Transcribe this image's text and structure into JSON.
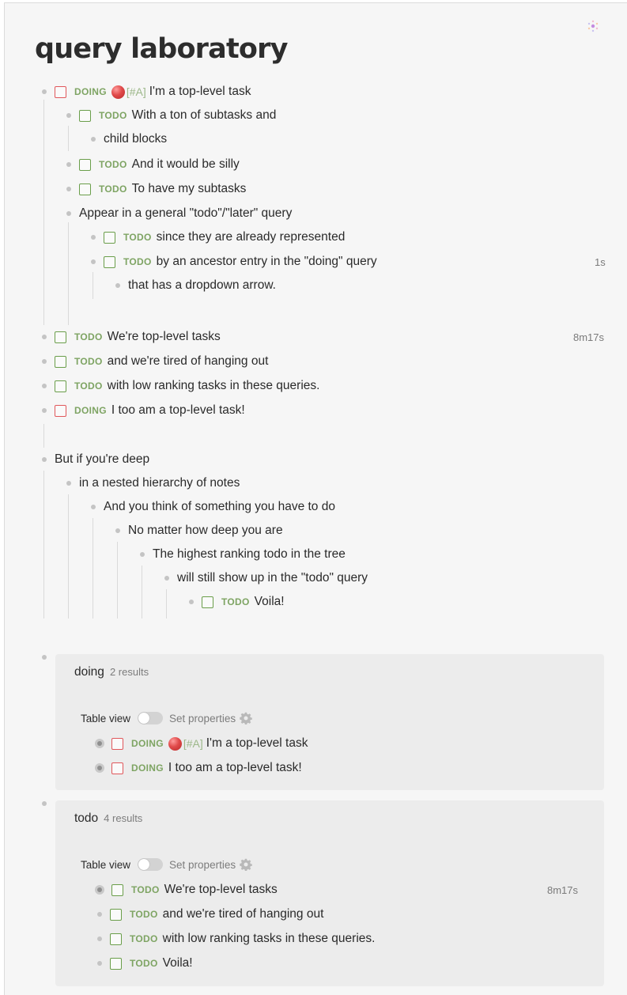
{
  "page": {
    "title": "query laboratory"
  },
  "markers": {
    "doing": "DOING",
    "todo": "TODO",
    "priority": "[#A]"
  },
  "outline": {
    "b1": "I'm a top-level task",
    "b1_1": "With a ton of subtasks and",
    "b1_1_1": "child blocks",
    "b1_2": "And it would be silly",
    "b1_3": "To have my  subtasks",
    "b1_4": "Appear in a general \"todo\"/\"later\" query",
    "b1_4_1": "since they are already represented",
    "b1_4_2": "by an ancestor entry in the \"doing\" query",
    "b1_4_2_time": "1s",
    "b1_4_2_1": "that has a dropdown arrow.",
    "b2": "We're top-level tasks",
    "b2_time": "8m17s",
    "b3": "and we're tired of hanging out",
    "b4": "with low ranking tasks in these queries.",
    "b5": "I too am a top-level task!",
    "b6": "But if you're deep",
    "b6_1": "in a nested hierarchy of notes",
    "b6_2": "And you think of something you have to do",
    "b6_3": "No matter how deep you are",
    "b6_4": "The highest ranking todo in the tree",
    "b6_5": "will still show up in the \"todo\" query",
    "b6_6": "Voila!"
  },
  "queries": {
    "doing": {
      "title": "doing",
      "count": "2 results",
      "table_view_label": "Table view",
      "set_properties_label": "Set properties",
      "table_view_on": false,
      "results": [
        "I'm a top-level task",
        "I too am a top-level task!"
      ]
    },
    "todo": {
      "title": "todo",
      "count": "4 results",
      "table_view_label": "Table view",
      "set_properties_label": "Set properties",
      "table_view_on": false,
      "results": [
        "We're top-level tasks",
        "and we're tired of hanging out",
        "with low ranking tasks in these queries.",
        "Voila!"
      ],
      "result_time": "8m17s"
    }
  },
  "colors": {
    "todo_checkbox": "#6a9e4a",
    "doing_checkbox": "#e0575b",
    "marker_text": "#7ea463",
    "priority_text": "#9db88a",
    "query_background": "#ececec",
    "page_background": "#f6f6f6"
  },
  "icons": {
    "sync": "sync-indicator-icon",
    "settings": "gear-icon",
    "priority": "priority-ball-icon"
  }
}
